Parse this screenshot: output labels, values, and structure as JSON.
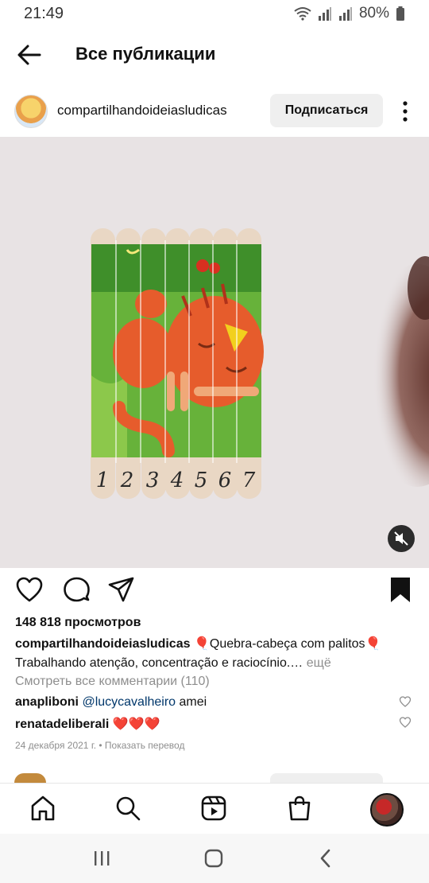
{
  "status_bar": {
    "time": "21:49",
    "battery": "80%"
  },
  "header": {
    "title": "Все публикации"
  },
  "post": {
    "username": "compartilhandoideiasludicas",
    "follow_label": "Подписаться",
    "views": "148 818 просмотров",
    "caption_username": "compartilhandoideiasludicas",
    "caption_text_1": "🎈Quebra-cabeça com palitos🎈",
    "caption_text_2": "Trabalhando atenção, concentração e raciocínio.…",
    "caption_more": "ещё",
    "view_comments": "Смотреть все комментарии (110)",
    "comments": [
      {
        "user": "anapliboni",
        "mention": "@lucycavalheiro",
        "text": " amei"
      },
      {
        "user": "renatadeliberali",
        "mention": "",
        "text": " ❤️❤️❤️"
      }
    ],
    "date": "24 декабря 2021 г. • Показать перевод",
    "stick_numbers": [
      "1",
      "2",
      "3",
      "4",
      "5",
      "6",
      "7"
    ]
  }
}
